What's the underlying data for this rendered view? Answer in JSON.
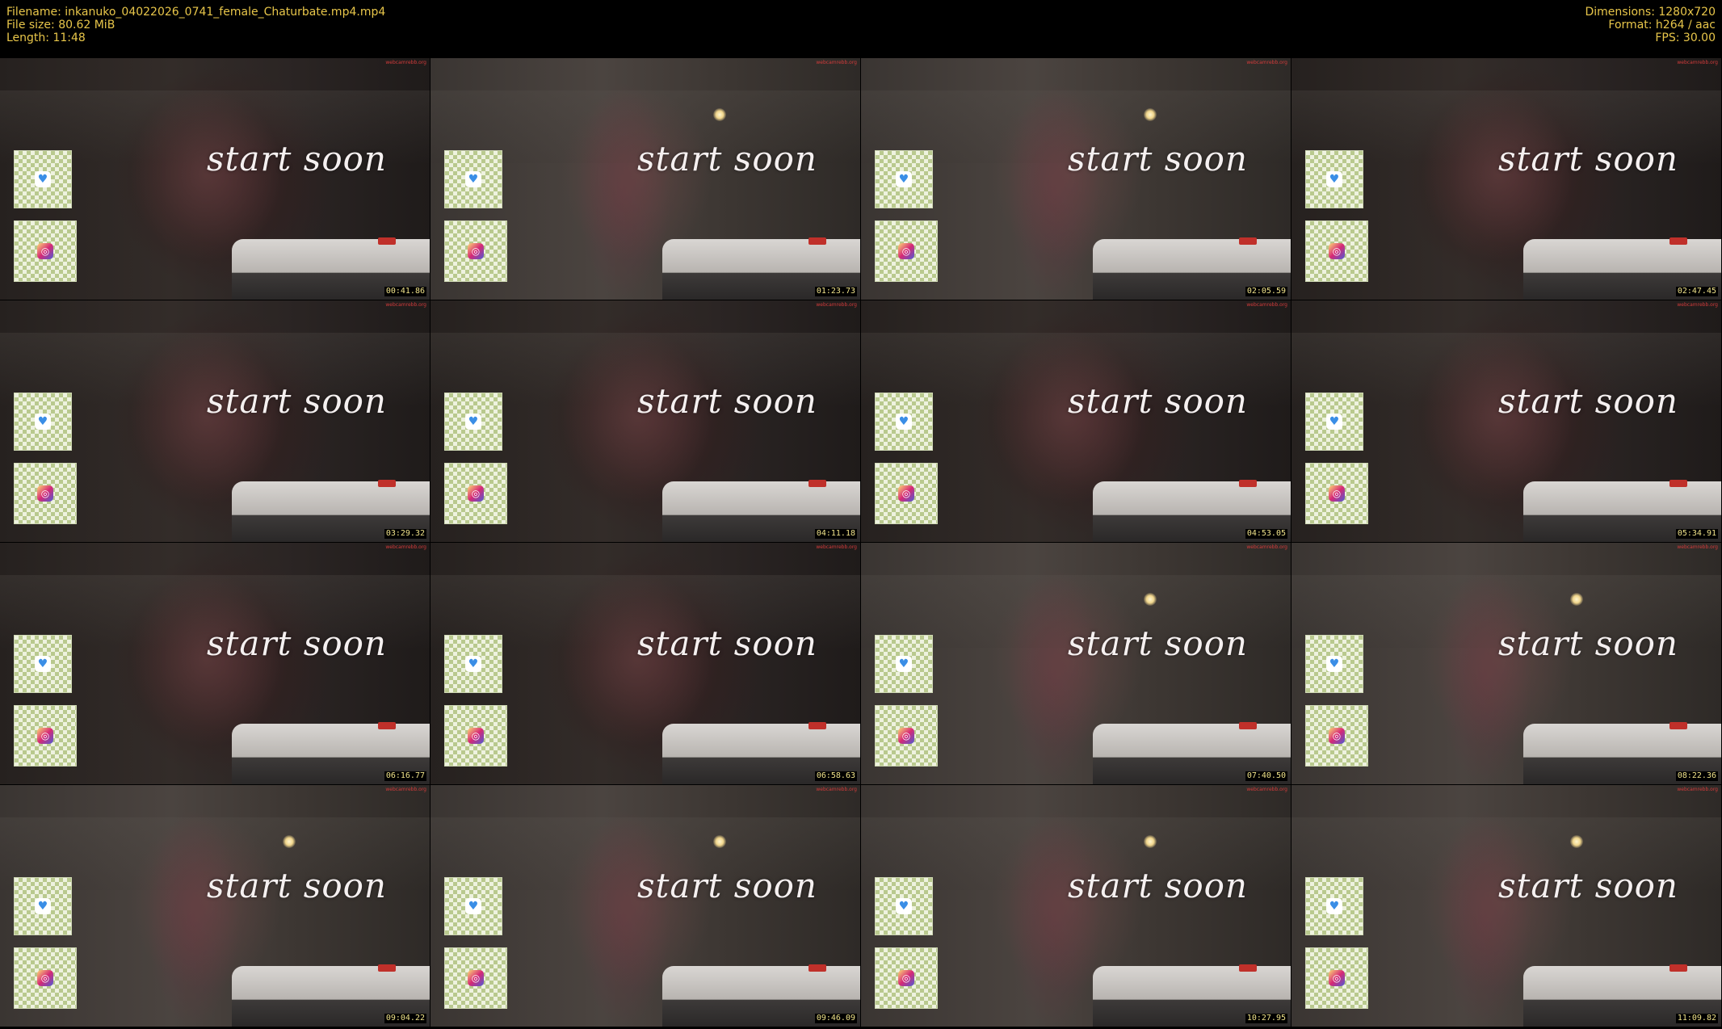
{
  "header": {
    "filename": "Filename: inkanuko_04022026_0741_female_Chaturbate.mp4.mp4",
    "filesize": "File size: 80.62 MiB",
    "length": "Length: 11:48",
    "dimensions": "Dimensions: 1280x720",
    "format": "Format: h264 / aac",
    "fps": "FPS: 30.00"
  },
  "overlay_text": "start soon",
  "watermark": "webcamrebb.org",
  "qr_icons": [
    "heart-icon",
    "instagram-icon"
  ],
  "colors": {
    "header_text": "#e8c64a",
    "timestamp_text": "#f0e38a",
    "background": "#000000"
  },
  "thumbnails": [
    {
      "time": "00:41.86",
      "view": "body"
    },
    {
      "time": "01:23.73",
      "view": "legs"
    },
    {
      "time": "02:05.59",
      "view": "legs"
    },
    {
      "time": "02:47.45",
      "view": "body"
    },
    {
      "time": "03:29.32",
      "view": "body"
    },
    {
      "time": "04:11.18",
      "view": "body"
    },
    {
      "time": "04:53.05",
      "view": "body"
    },
    {
      "time": "05:34.91",
      "view": "body"
    },
    {
      "time": "06:16.77",
      "view": "body"
    },
    {
      "time": "06:58.63",
      "view": "body"
    },
    {
      "time": "07:40.50",
      "view": "legs"
    },
    {
      "time": "08:22.36",
      "view": "legs"
    },
    {
      "time": "09:04.22",
      "view": "legs"
    },
    {
      "time": "09:46.09",
      "view": "legs"
    },
    {
      "time": "10:27.95",
      "view": "legs"
    },
    {
      "time": "11:09.82",
      "view": "legs"
    }
  ]
}
